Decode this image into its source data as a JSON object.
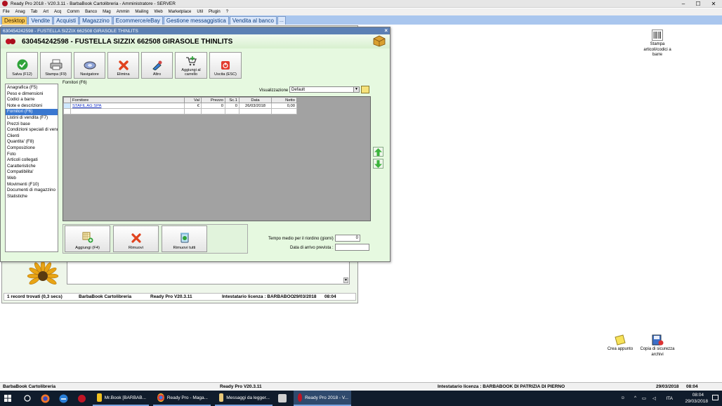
{
  "window": {
    "title": "Ready Pro 2018 - V20.3.11 - BarbaBook Cartolibreria - Amministratore - SERVER",
    "min": "–",
    "max": "☐",
    "close": "✕"
  },
  "menu": [
    "File",
    "Anag",
    "Tab",
    "Art",
    "Acq",
    "Comm",
    "Banco",
    "Mag",
    "Ammin",
    "Mailing",
    "Web",
    "Marketplace",
    "Util",
    "Plugin",
    "?"
  ],
  "tabs": [
    "Desktop",
    "Vendite",
    "Acquisti",
    "Magazzino",
    "Ecommerce/eBay",
    "Gestione messaggistica",
    "Vendita al banco",
    "..."
  ],
  "dialog": {
    "title": "630454242598 - FUSTELLA SIZZIX 662508 GIRASOLE THINLITS",
    "close": "×",
    "header": "630454242598 - FUSTELLA SIZZIX 662508 GIRASOLE THINLITS"
  },
  "toolbar": {
    "save": "Salva (F12)",
    "print": "Stampa (F9)",
    "navigator": "Navigatore",
    "delete": "Elimina",
    "other": "Altro",
    "cart_1": "Aggiungi al",
    "cart_2": "carrello",
    "exit": "Uscita (ESC)"
  },
  "nav": [
    "Anagrafica (F5)",
    "Peso e dimensioni",
    "Codici a barre",
    "Note e descrizioni",
    "Fornitori (F6)",
    "Listini di vendita (F7)",
    "Prezzi base",
    "Condizioni speciali di vendita",
    "Clienti",
    "Quantita' (F8)",
    "Composizione",
    "Foto",
    "Articoli collegati",
    "Caratteristiche",
    "Compatibilita'",
    "Web",
    "Movimenti (F10)",
    "Documenti di magazzino",
    "Statistiche"
  ],
  "panel": {
    "label": "Fornitori (F6)",
    "viz_label": "Visualizzazione :",
    "viz_value": "Default",
    "viz_arrow": "▼",
    "columns": [
      "Fornitore",
      "Val",
      "Prezzo",
      "Sc.1",
      "Data",
      "Netto"
    ],
    "rows": [
      [
        "STAFIL AG SPA",
        "€",
        "0",
        "0",
        "26/03/2018",
        "0,00"
      ]
    ],
    "add": "Aggiungi (F4)",
    "remove": "Rimuovi",
    "remove_all": "Rimuovi tutti",
    "reorder_label": "Tempo medio per il riordino (giorni) :",
    "reorder_value": "0",
    "arrival_label": "Data di arrivo prevista :",
    "arrival_value": ""
  },
  "bgform": {
    "records": "1 record trovati (0,3 secs)",
    "company": "BarbaBook Cartolibreria",
    "version": "Ready Pro V20.3.11",
    "license": "Intestatario licenza : BARBABOO",
    "date": "29/03/2018",
    "time": "08:04",
    "scroll_arrow": "▼"
  },
  "desktop": {
    "barcode_1": "Stampa",
    "barcode_2": "articoli/codici a",
    "barcode_3": "barre",
    "note": "Crea appunto",
    "backup_1": "Copia di sicurezza",
    "backup_2": "archivi"
  },
  "statusbar": {
    "company": "BarbaBook Cartolibreria",
    "version": "Ready Pro V20.3.11",
    "license": "Intestatario licenza : BARBABOOK DI PATRIZIA DI PIERNO",
    "date": "29/03/2018",
    "time": "08:04"
  },
  "taskbar": {
    "items": [
      "Mr.Book [BARBAB...",
      "Ready Pro - Maga...",
      "Messaggi da legger...",
      "Ready Pro 2018 - V..."
    ],
    "lang": "ITA",
    "time": "08:04",
    "date": "29/03/2018"
  },
  "colors": {
    "accent_tab": "#f7c95a",
    "dialog_bg": "#e6f9e0",
    "selection": "#3a78d0",
    "taskbar": "#101c2c"
  }
}
